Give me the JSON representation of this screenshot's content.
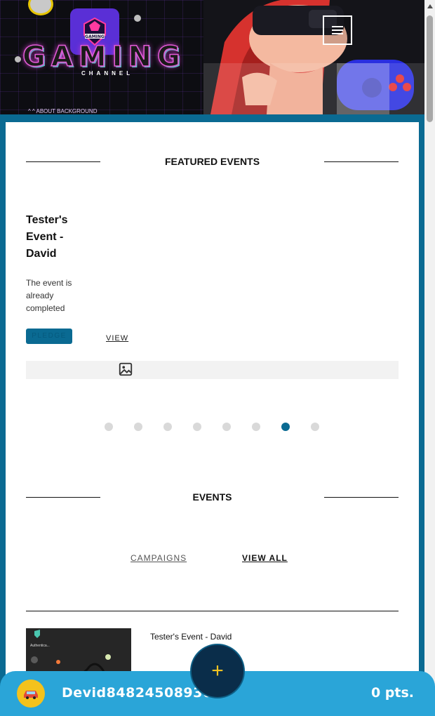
{
  "header": {
    "logo_word": "GAMING",
    "logo_sub": "CHANNEL",
    "badge_text": "GAMING",
    "strip_text": "^ ^      ABOUT BACKGROUND",
    "menu_icon": "hamburger-icon"
  },
  "featured": {
    "heading": "FEATURED EVENTS",
    "event_title": "Tester's Event - David",
    "event_desc": "The event is already completed",
    "pledge_label": "PLEDGE",
    "view_label": "VIEW",
    "image_icon": "image-icon",
    "carousel": {
      "total": 8,
      "active_index": 6
    }
  },
  "events": {
    "heading": "EVENTS",
    "tabs": [
      "CAMPAIGNS",
      "VIEW ALL"
    ],
    "active_tab": "VIEW ALL",
    "list": [
      {
        "title": "Tester's Event - David",
        "thumb_text": "Authentica..."
      }
    ]
  },
  "user_bar": {
    "username": "Devid84824508936",
    "points": "0 pts.",
    "avatar_icon": "car-icon",
    "fab_label": "+"
  },
  "colors": {
    "accent": "#0a6a92",
    "bar": "#2aa5d8",
    "fab": "#0a2d4a",
    "fab_plus": "#f2c322",
    "avatar": "#f4c21c"
  }
}
